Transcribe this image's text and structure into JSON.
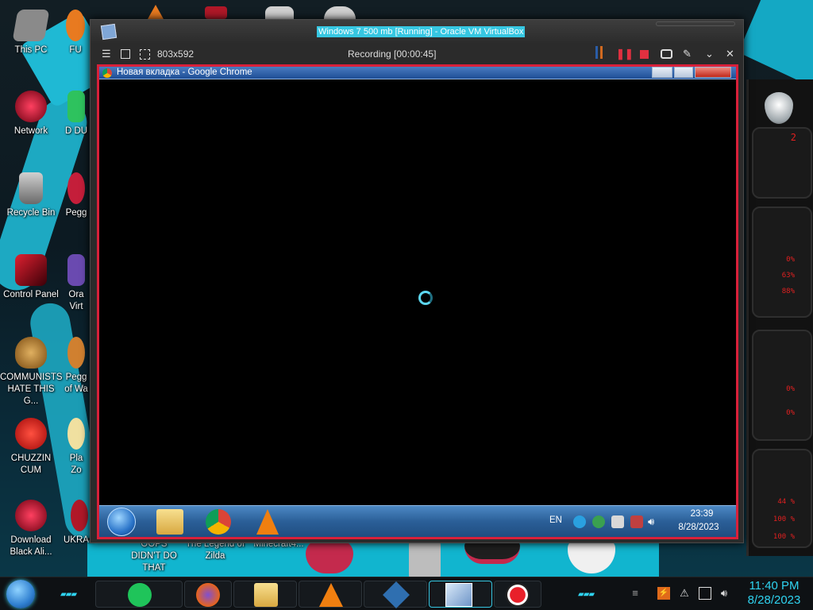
{
  "desktop": {
    "icons": [
      {
        "label": "This PC",
        "color": "#c0c0c0"
      },
      {
        "label": "Network",
        "color": "#b01828"
      },
      {
        "label": "Recycle Bin",
        "color": "#9b9b9b"
      },
      {
        "label": "Control Panel",
        "color": "#c01e2a"
      },
      {
        "label": "COMMUNISTS HATE THIS G...",
        "color": "#b07a2c"
      },
      {
        "label": "CHUZZIN CUM",
        "color": "#d42020"
      },
      {
        "label": "Download Black Ali...",
        "color": "#b01828"
      }
    ],
    "column2": [
      {
        "label": "FU"
      },
      {
        "label": "D DU"
      },
      {
        "label": "Pegg"
      },
      {
        "label": "Ora Virt"
      },
      {
        "label": "Pegg of Wa"
      },
      {
        "label": "Pla Zo"
      },
      {
        "label": "UKRAINE"
      }
    ],
    "bottom_labels": [
      "OOPS DIDN'T DO THAT",
      "The Legend of Zilda",
      "Minecraft4..."
    ]
  },
  "vbox": {
    "title": "Windows 7 500 mb [Running] - Oracle VM VirtualBox",
    "toolbar": {
      "resolution": "803x592",
      "recording": "Recording [00:00:45]"
    }
  },
  "guest": {
    "chrome_title": "Новая вкладка - Google Chrome",
    "tray": {
      "lang": "EN",
      "time": "23:39",
      "date": "8/28/2023"
    }
  },
  "gadget": {
    "readouts": [
      "2",
      "0%",
      "63%",
      "88%",
      "0%",
      "0%",
      "44 %",
      "100 %",
      "100 %"
    ]
  },
  "host_taskbar": {
    "time": "11:40 PM",
    "date": "8/28/2023",
    "accent": "#2fd3f0"
  }
}
